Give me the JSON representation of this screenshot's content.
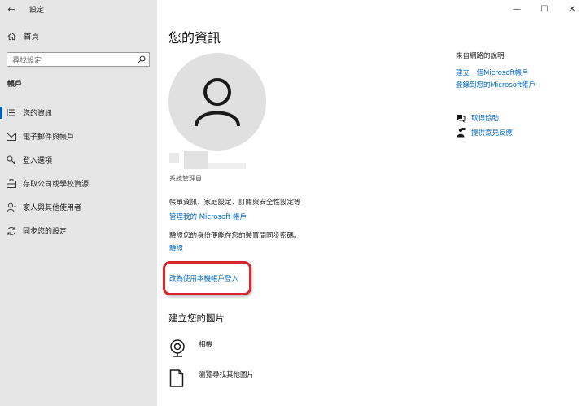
{
  "window": {
    "back_label": "←",
    "title": "設定",
    "controls": {
      "minimize": "—",
      "maximize": "☐",
      "close": "✕"
    }
  },
  "sidebar": {
    "home_label": "首頁",
    "search_placeholder": "尋找設定",
    "section_label": "帳戶",
    "items": [
      {
        "label": "您的資訊",
        "icon": "user-list-icon",
        "active": true
      },
      {
        "label": "電子郵件與帳戶",
        "icon": "mail-icon",
        "active": false
      },
      {
        "label": "登入選項",
        "icon": "key-icon",
        "active": false
      },
      {
        "label": "存取公司或學校資源",
        "icon": "briefcase-icon",
        "active": false
      },
      {
        "label": "家人與其他使用者",
        "icon": "people-icon",
        "active": false
      },
      {
        "label": "同步您的設定",
        "icon": "sync-icon",
        "active": false
      }
    ]
  },
  "main": {
    "title": "您的資訊",
    "role": "系統管理員",
    "billing_desc": "帳單資訊、家庭設定、訂閱與安全性設定等",
    "manage_link": "管理我的 Microsoft 帳戶",
    "verify_desc": "驗證您的身份便能在您的裝置間同步密碼。",
    "verify_link": "驗證",
    "local_account_link": "改為使用本機帳戶登入",
    "create_picture_title": "建立您的圖片",
    "picture_options": [
      {
        "label": "相機",
        "icon": "webcam-icon"
      },
      {
        "label": "瀏覽尋找其他圖片",
        "icon": "browse-file-icon"
      }
    ]
  },
  "help": {
    "title": "來自網路的說明",
    "links": [
      "建立一個Microsoft帳戶",
      "登錄到您的Microsoft帳戶"
    ],
    "get_help": "取得協助",
    "feedback": "提供意見反應"
  },
  "colors": {
    "accent": "#0067c0",
    "highlight_box": "#d9252b",
    "sidebar_bg": "#e6e6e6"
  }
}
